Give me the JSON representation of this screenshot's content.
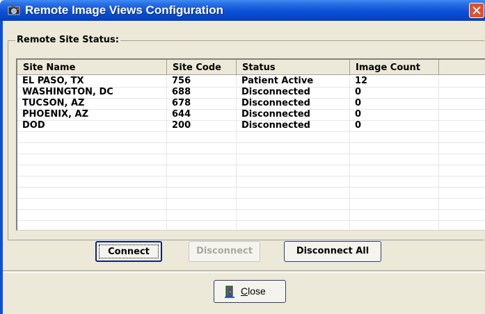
{
  "window": {
    "title": "Remote Image Views Configuration"
  },
  "group": {
    "label": "Remote Site Status:"
  },
  "table": {
    "columns": [
      "Site Name",
      "Site Code",
      "Status",
      "Image Count",
      ""
    ],
    "rows": [
      [
        "EL PASO, TX",
        "756",
        "Patient Active",
        "12"
      ],
      [
        "WASHINGTON, DC",
        "688",
        "Disconnected",
        "0"
      ],
      [
        "TUCSON, AZ",
        "678",
        "Disconnected",
        "0"
      ],
      [
        "PHOENIX, AZ",
        "644",
        "Disconnected",
        "0"
      ],
      [
        "DOD",
        "200",
        "Disconnected",
        "0"
      ]
    ]
  },
  "buttons": {
    "connect": "Connect",
    "disconnect": "Disconnect",
    "disconnect_all": "Disconnect All",
    "close": "Close"
  },
  "colors": {
    "title_bar": "#0a50d8",
    "window_bg": "#ece9d8",
    "close_x": "#e0502c"
  }
}
